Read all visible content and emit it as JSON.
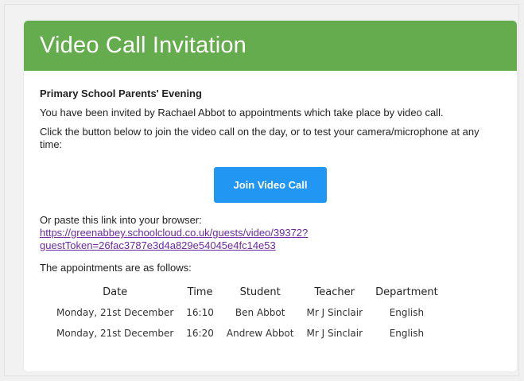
{
  "header": {
    "title": "Video Call Invitation"
  },
  "email": {
    "subject": "Primary School Parents' Evening",
    "invite_text": "You have been invited by Rachael Abbot to appointments which take place by video call.",
    "instructions": "Click the button below to join the video call on the day, or to test your camera/microphone at any time:",
    "join_button_label": "Join Video Call",
    "paste_text": "Or paste this link into your browser:",
    "link_line1": "https://greenabbey.schoolcloud.co.uk/guests/video/39372?",
    "link_line2": "guestToken=26fac3787e3d4a829e54045e4fc14e53",
    "appointments_intro": "The appointments are as follows:"
  },
  "appointments": {
    "headers": [
      "Date",
      "Time",
      "Student",
      "Teacher",
      "Department"
    ],
    "rows": [
      [
        "Monday, 21st December",
        "16:10",
        "Ben Abbot",
        "Mr J Sinclair",
        "English"
      ],
      [
        "Monday, 21st December",
        "16:20",
        "Andrew Abbot",
        "Mr J Sinclair",
        "English"
      ]
    ]
  },
  "colors": {
    "header_green": "#64ac4d",
    "button_blue": "#2196f3",
    "link_purple": "#6a2aa0"
  }
}
